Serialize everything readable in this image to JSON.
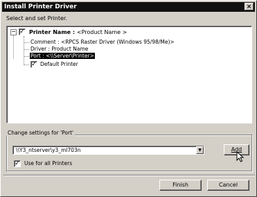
{
  "window": {
    "title": "Install Printer Driver",
    "close_glyph": "×",
    "subtitle": "Select and set Printer."
  },
  "tree": {
    "expander": "−",
    "root": {
      "checked": true,
      "label": "Printer Name : ",
      "value": "<Product  Name >"
    },
    "comment": "Comment : <RPCS Raster Driver (Windows 95/98/Me)>",
    "driver": "Driver : Product  Name",
    "port": "Port : <\\\\Server\\Printer>",
    "default_printer": {
      "checked": true,
      "label": "Default Printer"
    }
  },
  "port_settings": {
    "group_label": "Change settings for 'Port'",
    "port_value": "\\\\Y3_ntserver\\y3_ml703n",
    "add_button": "Add",
    "use_all_printers": {
      "checked": true,
      "label": "Use for all Printers"
    }
  },
  "footer": {
    "finish_button": "Finish",
    "cancel_button": "Cancel"
  },
  "icons": {
    "check_glyph": "✓",
    "dropdown_glyph": "▼"
  }
}
